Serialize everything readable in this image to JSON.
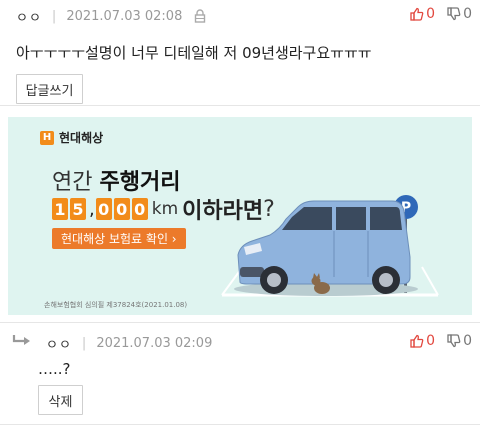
{
  "comment1": {
    "author": "ㅇㅇ",
    "date": "2021.07.03 02:08",
    "upvotes": "0",
    "downvotes": "0",
    "text": "아ㅜㅜㅜㅜ설명이 너무 디테일해 저 09년생라구요ㅠㅠㅠ",
    "reply_button": "답글쓰기"
  },
  "ad": {
    "brand": "현대해상",
    "brand_mark": "H",
    "headline_prefix": "연간 ",
    "headline_bold": "주행거리",
    "digits_a": [
      "1",
      "5"
    ],
    "digits_b": [
      "0",
      "0",
      "0"
    ],
    "comma": ",",
    "unit": "km",
    "tail": " 이하라면",
    "question": "?",
    "cta": "현대해상 보험료 확인 ›",
    "fine_print": "손해보험협회 심의필 제37824호(2021.01.08)",
    "parking_sign": "P",
    "colors": {
      "brand_orange": "#f28c1a",
      "background": "#dff4f0",
      "car": "#8fb3dd"
    }
  },
  "comment2": {
    "author": "ㅇㅇ",
    "date": "2021.07.03 02:09",
    "upvotes": "0",
    "downvotes": "0",
    "text": "…..?",
    "delete_button": "삭제"
  },
  "icons": [
    "lock-icon",
    "thumbs-up-icon",
    "thumbs-down-icon",
    "reply-arrow-icon"
  ]
}
